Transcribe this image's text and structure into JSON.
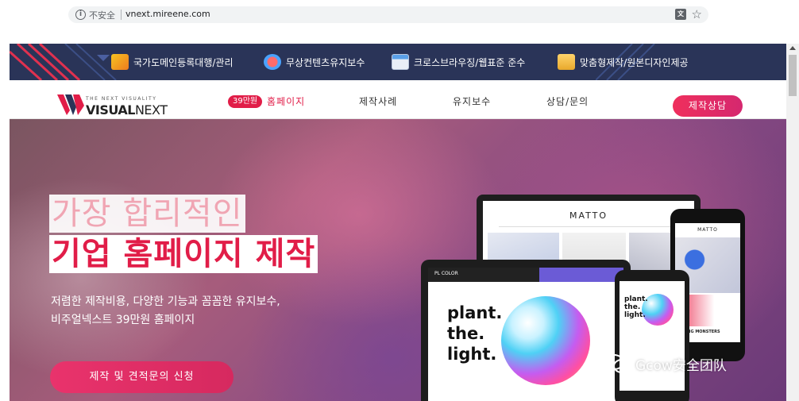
{
  "browser": {
    "security_label": "不安全",
    "url": "vnext.mireene.com",
    "icons": [
      "info-icon",
      "translate-icon",
      "star-icon"
    ]
  },
  "top_strip": {
    "items": [
      {
        "label": "국가도메인등록대행/관리",
        "icon": "domain-icon"
      },
      {
        "label": "무상컨텐츠유지보수",
        "icon": "puzzle-icon"
      },
      {
        "label": "크로스브라우징/웹표준 준수",
        "icon": "browser-window-icon"
      },
      {
        "label": "맞춤형제작/원본디자인제공",
        "icon": "folder-icon"
      }
    ],
    "colors": {
      "background": "#2a3458",
      "accent": "#e11d48"
    }
  },
  "nav": {
    "logo_tagline": "THE NEXT VISUALITY",
    "logo_bold": "VISUAL",
    "logo_light": "NEXT",
    "badge": "39만원",
    "links": [
      "홈페이지",
      "제작사례",
      "유지보수",
      "상담/문의"
    ],
    "active_index": 0,
    "consult_button": "제작상담"
  },
  "hero": {
    "headline_line1": "가장 합리적인",
    "headline_line2": "기업 홈페이지 제작",
    "sub_line1": "저렴한 제작비용, 다양한 기능과 꼼꼼한 유지보수,",
    "sub_line2": "비주얼넥스트 39만원 홈페이지",
    "cta": "제작 및 견적문의 신청",
    "mockup": {
      "laptop_site": "MATTO",
      "tablet_brand": "PL COLOR",
      "tablet_headline": "plant.\nthe.\nlight.",
      "phone_brand": "MATTO",
      "phone_caption": "FLYING MONSTERS",
      "small_phone_headline": "plant.\nthe.\nlight."
    }
  },
  "watermark": {
    "text": "Gcow安全团队"
  },
  "colors": {
    "brand_red": "#e11d48",
    "hero_purple": "#8a4b83"
  }
}
